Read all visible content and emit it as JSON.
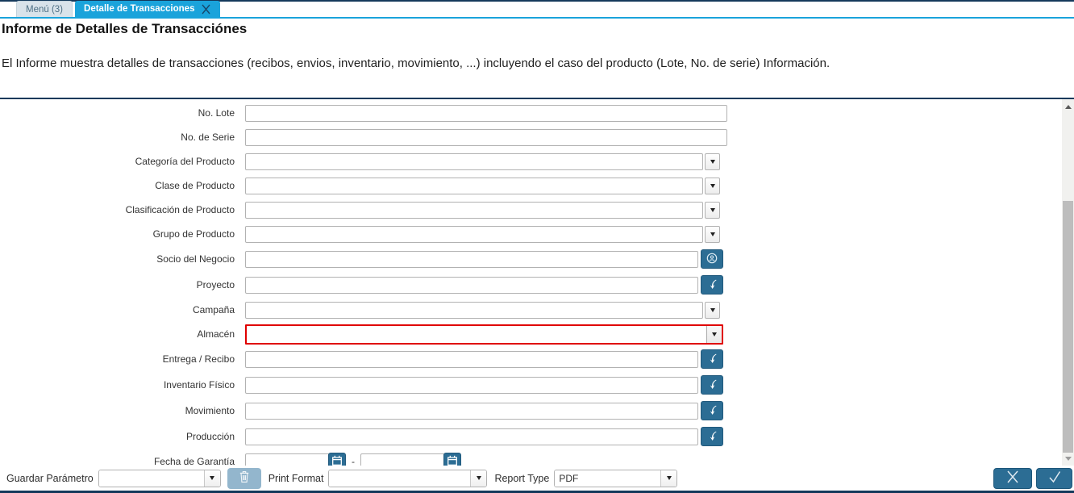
{
  "tabs": [
    {
      "label": "Menú (3)"
    },
    {
      "label": "Detalle de Transacciones"
    }
  ],
  "header": {
    "title": "Informe de Detalles de Transacciónes",
    "description": "El Informe muestra detalles de transacciones (recibos, envios, inventario, movimiento, ...) incluyendo el caso del producto (Lote, No. de serie) Información."
  },
  "fields": [
    {
      "label": "No. Lote",
      "type": "text",
      "value": ""
    },
    {
      "label": "No. de Serie",
      "type": "text",
      "value": ""
    },
    {
      "label": "Categoría del Producto",
      "type": "combo",
      "value": ""
    },
    {
      "label": "Clase de Producto",
      "type": "combo",
      "value": ""
    },
    {
      "label": "Clasificación de Producto",
      "type": "combo",
      "value": ""
    },
    {
      "label": "Grupo de Producto",
      "type": "combo",
      "value": ""
    },
    {
      "label": "Socio del Negocio",
      "type": "lookup",
      "icon": "business-partner-icon",
      "value": ""
    },
    {
      "label": "Proyecto",
      "type": "lookup",
      "icon": "record-lookup-icon",
      "value": ""
    },
    {
      "label": "Campaña",
      "type": "combo",
      "value": ""
    },
    {
      "label": "Almacén",
      "type": "combo",
      "error": true,
      "value": ""
    },
    {
      "label": "Entrega / Recibo",
      "type": "lookup",
      "icon": "record-lookup-icon",
      "value": ""
    },
    {
      "label": "Inventario Físico",
      "type": "lookup",
      "icon": "record-lookup-icon",
      "value": ""
    },
    {
      "label": "Movimiento",
      "type": "lookup",
      "icon": "record-lookup-icon",
      "value": ""
    },
    {
      "label": "Producción",
      "type": "lookup",
      "icon": "record-lookup-icon",
      "value": ""
    },
    {
      "label": "Fecha de Garantía",
      "type": "daterange",
      "from_value": "",
      "to_value": "",
      "separator": "-"
    }
  ],
  "footer": {
    "save_param_label": "Guardar Parámetro",
    "save_param_value": "",
    "print_format_label": "Print Format",
    "print_format_value": "",
    "report_type_label": "Report Type",
    "report_type_value": "PDF"
  },
  "colors": {
    "accent_blue": "#1aa3db",
    "navy": "#14395b",
    "button_blue": "#2c6d94",
    "trash_button_blue": "#93b6cd",
    "error_red": "#e00000"
  }
}
